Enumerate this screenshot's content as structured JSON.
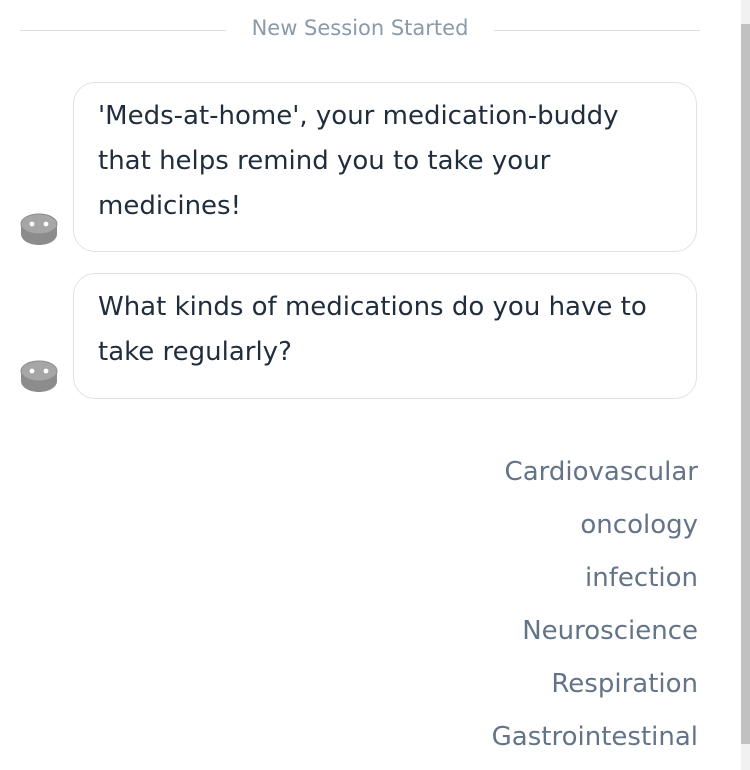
{
  "session": {
    "divider_text": "New Session Started"
  },
  "messages": [
    {
      "text": "'Meds-at-home', your medication-buddy that helps remind you to take your medicines!",
      "avatar_icon": "pill-bot-icon"
    },
    {
      "text": "What kinds of medications do you have to take regularly?",
      "avatar_icon": "pill-bot-icon"
    }
  ],
  "quick_replies": [
    "Cardiovascular",
    "oncology",
    "infection",
    "Neuroscience",
    "Respiration",
    "Gastrointestinal"
  ],
  "colors": {
    "bot_avatar": "#8c8c8c",
    "bubble_border": "#dfe3e7",
    "message_text": "#1f2d3d",
    "option_text": "#637488",
    "divider_text": "#8a9aa9"
  }
}
